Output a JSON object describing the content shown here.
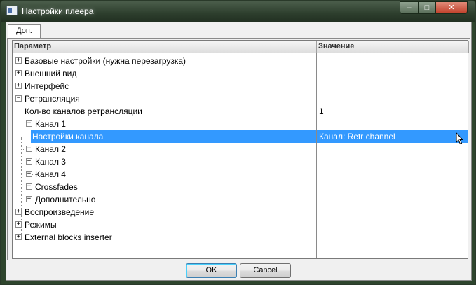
{
  "window": {
    "title": "Настройки плеера"
  },
  "tabs": [
    {
      "label": "Доп."
    }
  ],
  "grid": {
    "columns": {
      "param": "Параметр",
      "value": "Значение"
    },
    "rows": [
      {
        "label": "Базовые настройки (нужна перезагрузка)",
        "value": "",
        "expander": "+"
      },
      {
        "label": "Внешний вид",
        "value": "",
        "expander": "+"
      },
      {
        "label": "Интерфейс",
        "value": "",
        "expander": "+"
      },
      {
        "label": "Ретрансляция",
        "value": "",
        "expander": "−"
      },
      {
        "label": "Кол-во каналов ретрансляции",
        "value": "1",
        "expander": ""
      },
      {
        "label": "Канал 1",
        "value": "",
        "expander": "−"
      },
      {
        "label": "Настройки канала",
        "value": "Канал:  Retr channel",
        "expander": ""
      },
      {
        "label": "Канал 2",
        "value": "",
        "expander": "+"
      },
      {
        "label": "Канал 3",
        "value": "",
        "expander": "+"
      },
      {
        "label": "Канал 4",
        "value": "",
        "expander": "+"
      },
      {
        "label": "Crossfades",
        "value": "",
        "expander": "+"
      },
      {
        "label": "Дополнительно",
        "value": "",
        "expander": "+"
      },
      {
        "label": "Воспроизведение",
        "value": "",
        "expander": "+"
      },
      {
        "label": "Режимы",
        "value": "",
        "expander": "+"
      },
      {
        "label": "External blocks inserter",
        "value": "",
        "expander": "+"
      }
    ]
  },
  "buttons": {
    "ok": "OK",
    "cancel": "Cancel"
  },
  "window_buttons": {
    "minimize": "–",
    "maximize": "□",
    "close": "✕"
  }
}
